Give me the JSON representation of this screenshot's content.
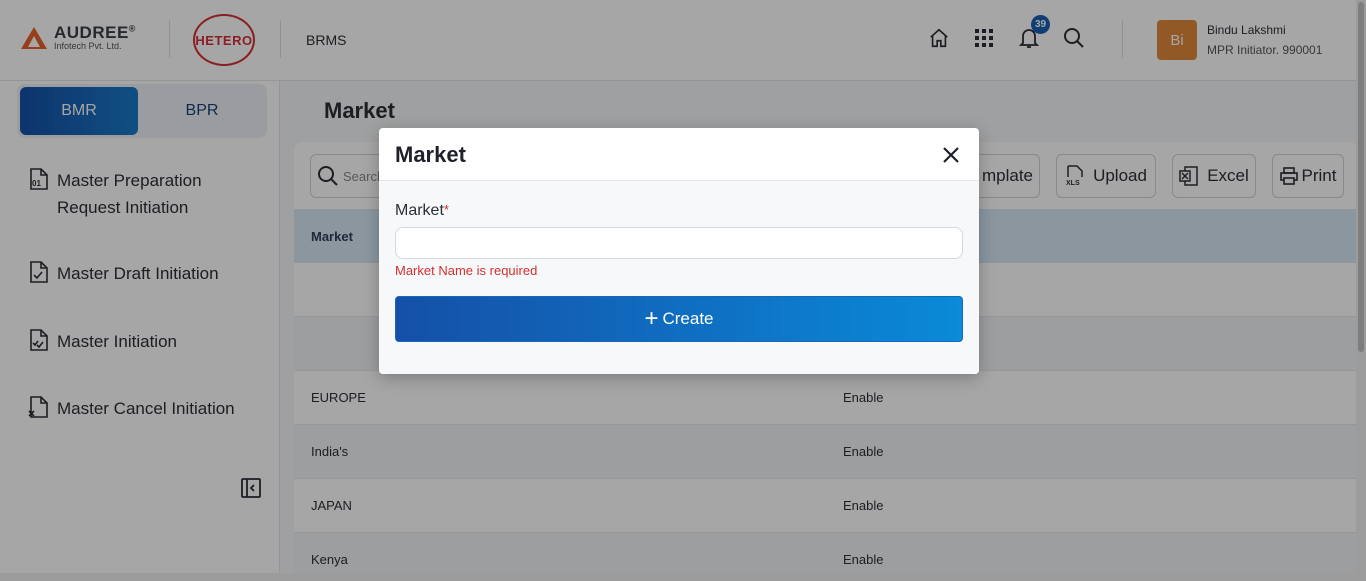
{
  "header": {
    "brand_name": "AUDREE",
    "brand_reg": "®",
    "brand_sub": "Infotech Pvt. Ltd.",
    "partner_logo": "HETERO",
    "app_name": "BRMS",
    "notification_count": "39",
    "user_initials": "Bi",
    "user_name": "Bindu Lakshmi",
    "user_role": "MPR Initiator. 990001"
  },
  "sidebar": {
    "toggle": [
      "BMR",
      "BPR"
    ],
    "items": [
      {
        "label": "Master Preparation Request Initiation",
        "icon": "document-01-icon"
      },
      {
        "label": "Master Draft Initiation",
        "icon": "document-check-icon"
      },
      {
        "label": "Master Initiation",
        "icon": "document-double-check-icon"
      },
      {
        "label": "Master Cancel Initiation",
        "icon": "document-x-icon"
      }
    ]
  },
  "main": {
    "title": "Market",
    "search_placeholder": "Search",
    "toolbar": {
      "template_label": "mplate",
      "upload_label": "Upload",
      "excel_label": "Excel",
      "print_label": "Print"
    },
    "table": {
      "headers": [
        "Market"
      ],
      "rows": [
        {
          "market": "",
          "status": ""
        },
        {
          "market": "",
          "status": ""
        },
        {
          "market": "EUROPE",
          "status": "Enable"
        },
        {
          "market": "India's",
          "status": "Enable"
        },
        {
          "market": "JAPAN",
          "status": "Enable"
        },
        {
          "market": "Kenya",
          "status": "Enable"
        }
      ]
    }
  },
  "modal": {
    "title": "Market",
    "field_label": "Market",
    "required_mark": "*",
    "field_value": "",
    "error": "Market Name is required",
    "create_label": "Create"
  },
  "colors": {
    "primary": "#1550a8",
    "accent": "#0a8ad8",
    "error": "#d32f2f",
    "avatar": "#e0883a",
    "brand_red": "#d3303a"
  }
}
